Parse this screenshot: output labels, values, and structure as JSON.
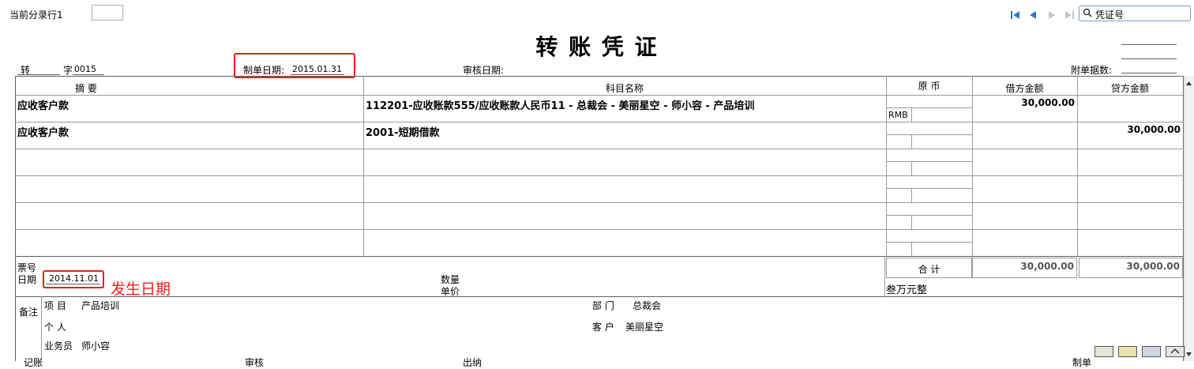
{
  "top": {
    "current_line_label": "当前分录行1",
    "search_placeholder": "凭证号"
  },
  "title": "转 账 凭 证",
  "header": {
    "voucher_type": "转",
    "voucher_no_label": "字",
    "voucher_no": "0015",
    "make_date_label": "制单日期:",
    "make_date": "2015.01.31",
    "audit_date_label": "审核日期:",
    "attachment_label": "附单据数:"
  },
  "columns": {
    "summary": "摘 要",
    "account": "科目名称",
    "original_currency": "原 币",
    "debit": "借方金额",
    "credit": "贷方金额"
  },
  "entries": [
    {
      "summary": "应收客户款",
      "account": "112201-应收账款555/应收账款人民币11 - 总裁会 - 美丽星空 - 师小容 - 产品培训",
      "currency": "RMB",
      "debit": "30,000.00",
      "credit": ""
    },
    {
      "summary": "应收客户款",
      "account": "2001-短期借款",
      "currency": "",
      "debit": "",
      "credit": "30,000.00"
    },
    {
      "summary": "",
      "account": "",
      "currency": "",
      "debit": "",
      "credit": ""
    },
    {
      "summary": "",
      "account": "",
      "currency": "",
      "debit": "",
      "credit": ""
    },
    {
      "summary": "",
      "account": "",
      "currency": "",
      "debit": "",
      "credit": ""
    },
    {
      "summary": "",
      "account": "",
      "currency": "",
      "debit": "",
      "credit": ""
    }
  ],
  "footer": {
    "ticket_no_label": "票号",
    "date_label": "日期",
    "occur_date": "2014.11.01",
    "annotation": "发生日期",
    "quantity_label": "数量",
    "unit_price_label": "单价",
    "total_label": "合 计",
    "total_debit": "30,000.00",
    "total_credit": "30,000.00",
    "amount_words": "叁万元整"
  },
  "remarks": {
    "label": "备注",
    "project_label": "项 目",
    "project": "产品培训",
    "department_label": "部 门",
    "department": "总裁会",
    "person_label": "个 人",
    "customer_label": "客 户",
    "customer": "美丽星空",
    "salesperson_label": "业务员",
    "salesperson": "师小容"
  },
  "bottom_partial": {
    "bookkeep": "记账",
    "audit": "审核",
    "cashier": "出纳",
    "maker": "制单"
  },
  "colors": {
    "highlight": "#e8201a",
    "nav_blue": "#2e7bd1"
  }
}
